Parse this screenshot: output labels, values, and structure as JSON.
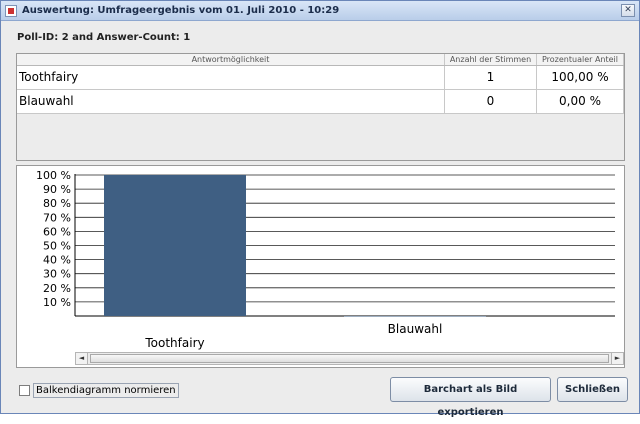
{
  "window": {
    "title": "Auswertung: Umfrageergebnis vom 01. Juli 2010 - 10:29",
    "close_glyph": "✕"
  },
  "info": {
    "text": "Poll-ID: 2 and Answer-Count: 1"
  },
  "table": {
    "columns": [
      "Antwortmöglichkeit",
      "Anzahl der Stimmen",
      "Prozentualer Anteil"
    ],
    "rows": [
      {
        "answer": "Toothfairy",
        "votes": "1",
        "percent": "100,00  %"
      },
      {
        "answer": "Blauwahl",
        "votes": "0",
        "percent": "0,00  %"
      }
    ]
  },
  "chart_data": {
    "type": "bar",
    "categories": [
      "Toothfairy",
      "Blauwahl"
    ],
    "values": [
      100,
      0
    ],
    "ylim": [
      0,
      100
    ],
    "yticks": [
      "10 %",
      "20 %",
      "30 %",
      "40 %",
      "50 %",
      "60 %",
      "70 %",
      "80 %",
      "90 %",
      "100 %"
    ],
    "grid": true,
    "bar_color": "#3f5f83"
  },
  "scrollbar": {
    "left_glyph": "◄",
    "right_glyph": "►"
  },
  "footer": {
    "normalize_label": "Balkendiagramm normieren",
    "export_label": "Barchart als Bild exportieren",
    "close_label": "Schließen"
  }
}
